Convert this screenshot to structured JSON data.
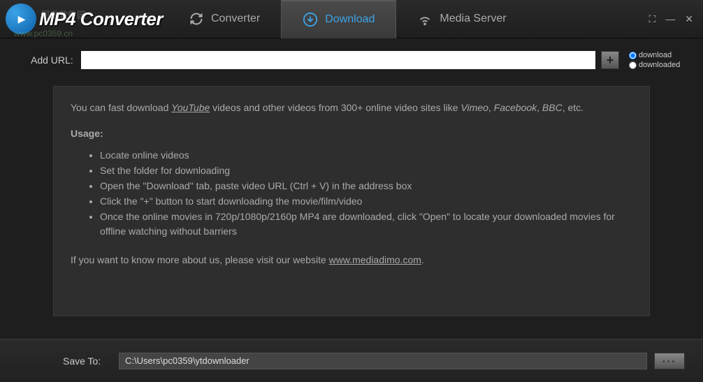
{
  "app": {
    "title": "MP4 Converter",
    "watermark": "河东软件园",
    "watermark_url": "www.pc0359.cn"
  },
  "tabs": {
    "converter": "Converter",
    "download": "Download",
    "media_server": "Media Server"
  },
  "url_bar": {
    "label": "Add URL:",
    "value": "",
    "add_icon": "+"
  },
  "filters": {
    "download": "download",
    "downloaded": "downloaded"
  },
  "content": {
    "intro_pre": "You can fast download ",
    "intro_yt": "YouTube",
    "intro_mid": " videos and other videos from 300+ online video sites like ",
    "intro_v": "Vimeo",
    "intro_sep1": ", ",
    "intro_fb": "Facebook",
    "intro_sep2": ", ",
    "intro_bbc": "BBC",
    "intro_post": ", etc.",
    "usage_title": "Usage:",
    "usage": [
      "Locate online videos",
      "Set the folder for downloading",
      "Open the \"Download\" tab, paste video URL (Ctrl + V) in the address box",
      "Click the \"+\" button to start downloading the movie/film/video",
      "Once the online movies in 720p/1080p/2160p MP4 are downloaded, click \"Open\" to locate your downloaded movies for offline watching without barriers"
    ],
    "more_pre": "If you want to know more about us, please visit our website ",
    "more_url": "www.mediadimo.com",
    "more_post": "."
  },
  "bottom": {
    "label": "Save To:",
    "path": "C:\\Users\\pc0359\\ytdownloader",
    "browse": "···"
  }
}
